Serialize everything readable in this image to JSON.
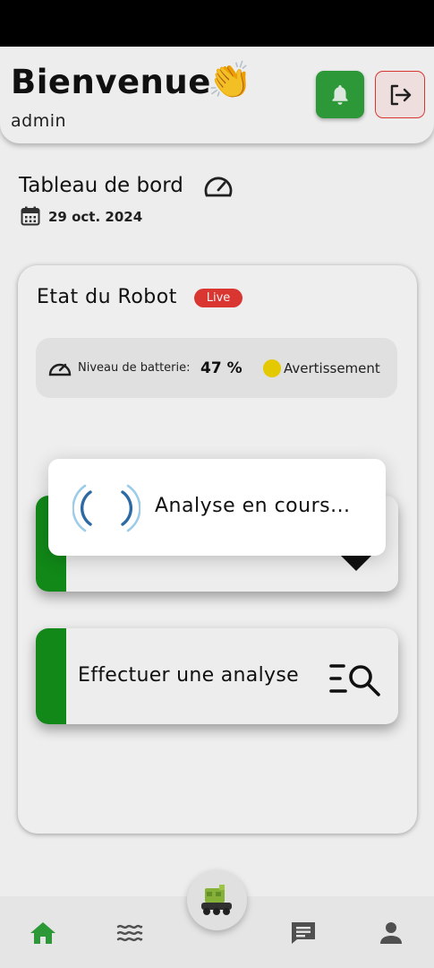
{
  "header": {
    "greeting": "Bienvenue",
    "emoji": "👏",
    "username": "admin",
    "bell_icon": "bell-icon",
    "logout_icon": "logout-icon"
  },
  "dashboard": {
    "title": "Tableau de bord",
    "date": "29 oct. 2024"
  },
  "robot_status": {
    "title": "Etat du Robot",
    "live_badge": "Live",
    "battery_label": "Niveau de batterie:",
    "battery_value": "47 %",
    "warning_label": "Avertissement"
  },
  "actions": {
    "analyze_label": "Effectuer une analyse"
  },
  "dialog": {
    "message": "Analyse en cours..."
  },
  "nav": [
    "home-icon",
    "waves-icon",
    "robot-icon",
    "chat-icon",
    "profile-icon"
  ],
  "colors": {
    "accent_green": "#12901a",
    "bell_green": "#2fa13a",
    "live_red": "#e53935",
    "warning_yellow": "#f2d400",
    "spinner_blue": "#7fb3d9"
  }
}
